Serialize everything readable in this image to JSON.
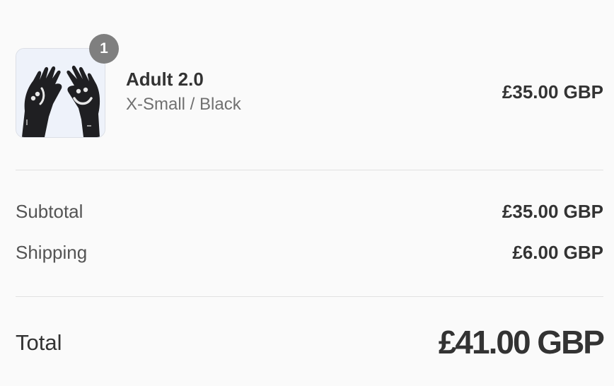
{
  "line_item": {
    "quantity": "1",
    "name": "Adult 2.0",
    "variant": "X-Small / Black",
    "price": "£35.00 GBP",
    "image_icon": "gloves-product-image"
  },
  "summary": {
    "subtotal_label": "Subtotal",
    "subtotal_value": "£35.00 GBP",
    "shipping_label": "Shipping",
    "shipping_value": "£6.00 GBP"
  },
  "total": {
    "label": "Total",
    "value": "£41.00 GBP"
  },
  "colors": {
    "background": "#fafafa",
    "badge": "#7f7f7f",
    "text": "#333333",
    "muted": "#707070"
  }
}
